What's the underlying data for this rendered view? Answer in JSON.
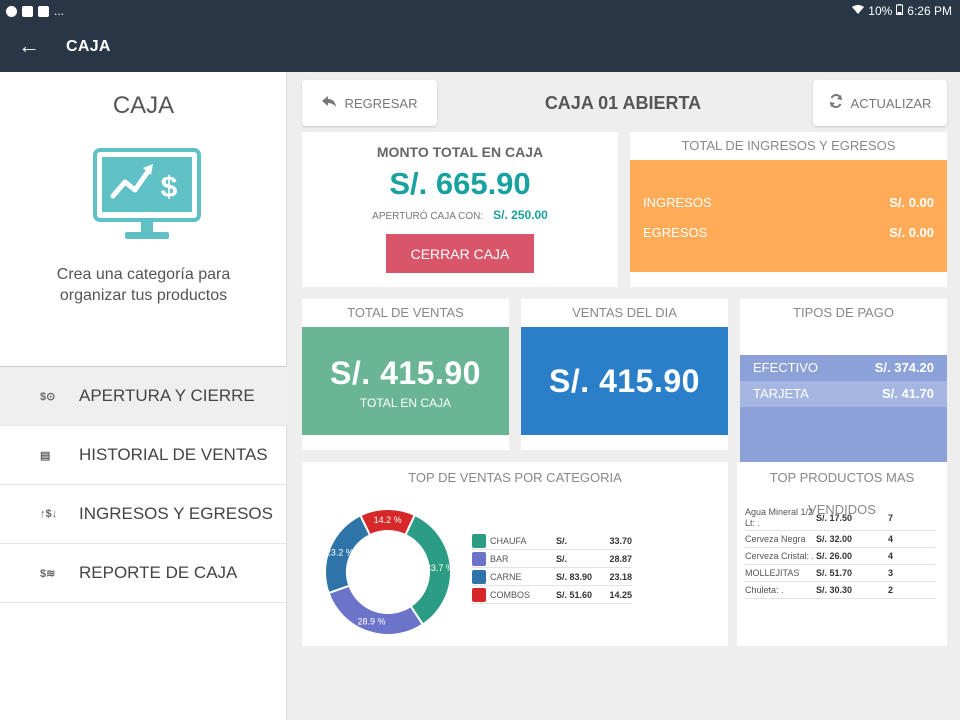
{
  "status": {
    "battery": "10%",
    "time": "6:26 PM",
    "more": "..."
  },
  "appbar": {
    "title": "CAJA",
    "back_icon": "←"
  },
  "sidebar": {
    "title": "CAJA",
    "description": "Crea una categoría para organizar tus productos",
    "items": [
      {
        "label": "APERTURA Y CIERRE",
        "icon": "$⊙",
        "active": true
      },
      {
        "label": "HISTORIAL DE VENTAS",
        "icon": "▤"
      },
      {
        "label": "INGRESOS Y EGRESOS",
        "icon": "↑$↓"
      },
      {
        "label": "REPORTE DE CAJA",
        "icon": "$≋"
      }
    ]
  },
  "header": {
    "back_label": "REGRESAR",
    "title": "CAJA 01 ABIERTA",
    "refresh_label": "ACTUALIZAR"
  },
  "monto": {
    "label": "MONTO TOTAL EN CAJA",
    "value": "S/. 665.90",
    "apertura_label": "APERTURÓ CAJA CON:",
    "apertura_value": "S/. 250.00",
    "close_button": "CERRAR CAJA"
  },
  "ingresos_egresos": {
    "title": "TOTAL DE INGRESOS Y EGRESOS",
    "rows": [
      {
        "label": "INGRESOS",
        "value": "S/. 0.00"
      },
      {
        "label": "EGRESOS",
        "value": "S/. 0.00"
      }
    ]
  },
  "total_ventas": {
    "title": "TOTAL DE VENTAS",
    "value": "S/. 415.90",
    "sub": "TOTAL EN CAJA"
  },
  "ventas_dia": {
    "title": "VENTAS DEL DIA",
    "value": "S/. 415.90"
  },
  "tipos_pago": {
    "title": "TIPOS DE PAGO",
    "rows": [
      {
        "label": "EFECTIVO",
        "value": "S/. 374.20"
      },
      {
        "label": "TARJETA",
        "value": "S/. 41.70"
      }
    ]
  },
  "top_categoria": {
    "title": "TOP DE VENTAS POR CATEGORIA"
  },
  "chart_data": {
    "type": "pie",
    "title": "TOP DE VENTAS POR CATEGORIA",
    "categories": [
      "CHAUFA",
      "BAR",
      "CARNE",
      "COMBOS"
    ],
    "values": [
      33.7,
      28.9,
      23.2,
      14.2
    ],
    "slice_labels": [
      "33.7 %",
      "28.9 %",
      "23.2 %",
      "14.2 %"
    ],
    "colors": [
      "#2c9c84",
      "#6b74c9",
      "#2f74a8",
      "#d62828"
    ],
    "legend": [
      {
        "name": "CHAUFA",
        "currency": "S/.",
        "value": "33.70"
      },
      {
        "name": "BAR",
        "currency": "S/.",
        "value": "28.87"
      },
      {
        "name": "CARNE",
        "currency": "S/. 83.90",
        "value": "23.18"
      },
      {
        "name": "COMBOS",
        "currency": "S/. 51.60",
        "value": "14.25"
      }
    ]
  },
  "top_productos": {
    "title": "TOP PRODUCTOS MAS VENDIDOS",
    "rows": [
      {
        "name": "Agua Mineral 1/2 Lt: .",
        "amount": "S/. 17.50",
        "qty": "7"
      },
      {
        "name": "Cerveza Negra",
        "amount": "S/. 32.00",
        "qty": "4"
      },
      {
        "name": "Cerveza Cristal: .",
        "amount": "S/. 26.00",
        "qty": "4"
      },
      {
        "name": "MOLLEJITAS",
        "amount": "S/. 51.70",
        "qty": "3"
      },
      {
        "name": "Chuleta: .",
        "amount": "S/. 30.30",
        "qty": "2"
      }
    ]
  }
}
